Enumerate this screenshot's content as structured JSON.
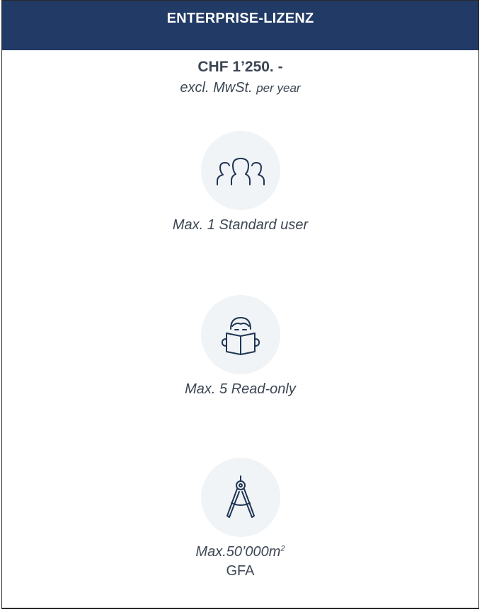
{
  "header": {
    "title": "ENTERPRISE-LIZENZ"
  },
  "pricing": {
    "price": "CHF 1’250. -",
    "tax_note": "excl. MwSt.",
    "period": "per year"
  },
  "features": [
    {
      "icon": "users-group-icon",
      "label": "Max. 1 Standard user"
    },
    {
      "icon": "reading-person-icon",
      "label": "Max. 5 Read-only"
    },
    {
      "icon": "drafting-compass-icon",
      "label": "Max.50’000m",
      "superscript": "2",
      "sublabel": "GFA"
    }
  ],
  "colors": {
    "header_bg": "#213a66",
    "text": "#3c4654",
    "icon_stroke": "#1f3553",
    "icon_bg": "#f0f4f7"
  }
}
